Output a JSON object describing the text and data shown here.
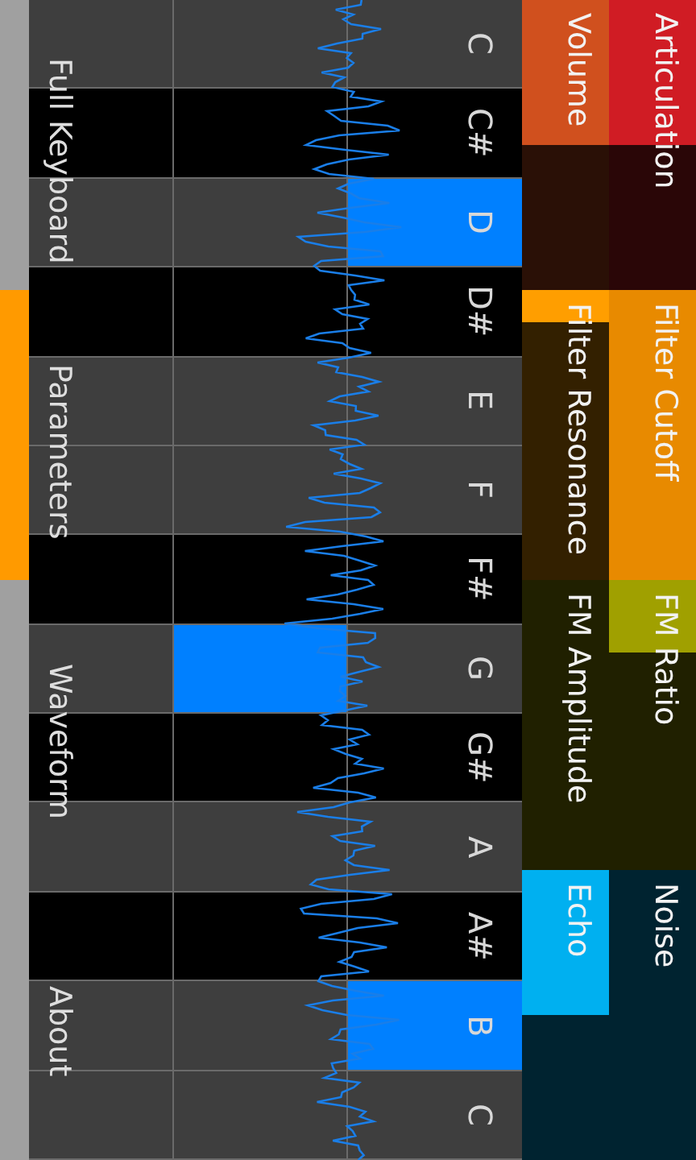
{
  "menu": [
    {
      "label": "Full Keyboard",
      "selected": false
    },
    {
      "label": "Parameters",
      "selected": true
    },
    {
      "label": "Waveform",
      "selected": false
    },
    {
      "label": "About",
      "selected": false
    }
  ],
  "keys": [
    {
      "label": "C",
      "kind": "natural",
      "cells": [
        {
          "pressed": false
        },
        {
          "pressed": false
        },
        {
          "pressed": false
        }
      ]
    },
    {
      "label": "C#",
      "kind": "sharp",
      "cells": [
        {
          "pressed": false
        },
        {
          "pressed": false
        },
        {
          "pressed": false
        }
      ]
    },
    {
      "label": "D",
      "kind": "natural",
      "cells": [
        {
          "pressed": false
        },
        {
          "pressed": false
        },
        {
          "pressed": true
        }
      ]
    },
    {
      "label": "D#",
      "kind": "sharp",
      "cells": [
        {
          "pressed": false
        },
        {
          "pressed": false
        },
        {
          "pressed": false
        }
      ]
    },
    {
      "label": "E",
      "kind": "natural",
      "cells": [
        {
          "pressed": false
        },
        {
          "pressed": false
        },
        {
          "pressed": false
        }
      ]
    },
    {
      "label": "F",
      "kind": "natural",
      "cells": [
        {
          "pressed": false
        },
        {
          "pressed": false
        },
        {
          "pressed": false
        }
      ]
    },
    {
      "label": "F#",
      "kind": "sharp",
      "cells": [
        {
          "pressed": false
        },
        {
          "pressed": false
        },
        {
          "pressed": false
        }
      ]
    },
    {
      "label": "G",
      "kind": "natural",
      "cells": [
        {
          "pressed": false
        },
        {
          "pressed": true
        },
        {
          "pressed": false
        }
      ]
    },
    {
      "label": "G#",
      "kind": "sharp",
      "cells": [
        {
          "pressed": false
        },
        {
          "pressed": false
        },
        {
          "pressed": false
        }
      ]
    },
    {
      "label": "A",
      "kind": "natural",
      "cells": [
        {
          "pressed": false
        },
        {
          "pressed": false
        },
        {
          "pressed": false
        }
      ]
    },
    {
      "label": "A#",
      "kind": "sharp",
      "cells": [
        {
          "pressed": false
        },
        {
          "pressed": false
        },
        {
          "pressed": false
        }
      ]
    },
    {
      "label": "B",
      "kind": "natural",
      "cells": [
        {
          "pressed": false
        },
        {
          "pressed": false
        },
        {
          "pressed": true
        }
      ]
    },
    {
      "label": "C",
      "kind": "natural",
      "cells": [
        {
          "pressed": false
        },
        {
          "pressed": false
        },
        {
          "pressed": false
        }
      ]
    }
  ],
  "parameters": [
    {
      "label": "Articulation",
      "level": 0.5,
      "color": "#d01c24"
    },
    {
      "label": "Volume",
      "level": 0.5,
      "color": "#d0501e"
    },
    {
      "label": "Filter Cutoff",
      "level": 1,
      "color": "#e88a00"
    },
    {
      "label": "Filter Resonance",
      "level": 0.11,
      "color": "#ff9e00"
    },
    {
      "label": "FM Ratio",
      "level": 0.25,
      "color": "#a0a000"
    },
    {
      "label": "FM Amplitude"
    },
    {
      "label": "Noise"
    },
    {
      "label": "Echo",
      "level": 0.5,
      "color": "#00b0f0"
    }
  ]
}
